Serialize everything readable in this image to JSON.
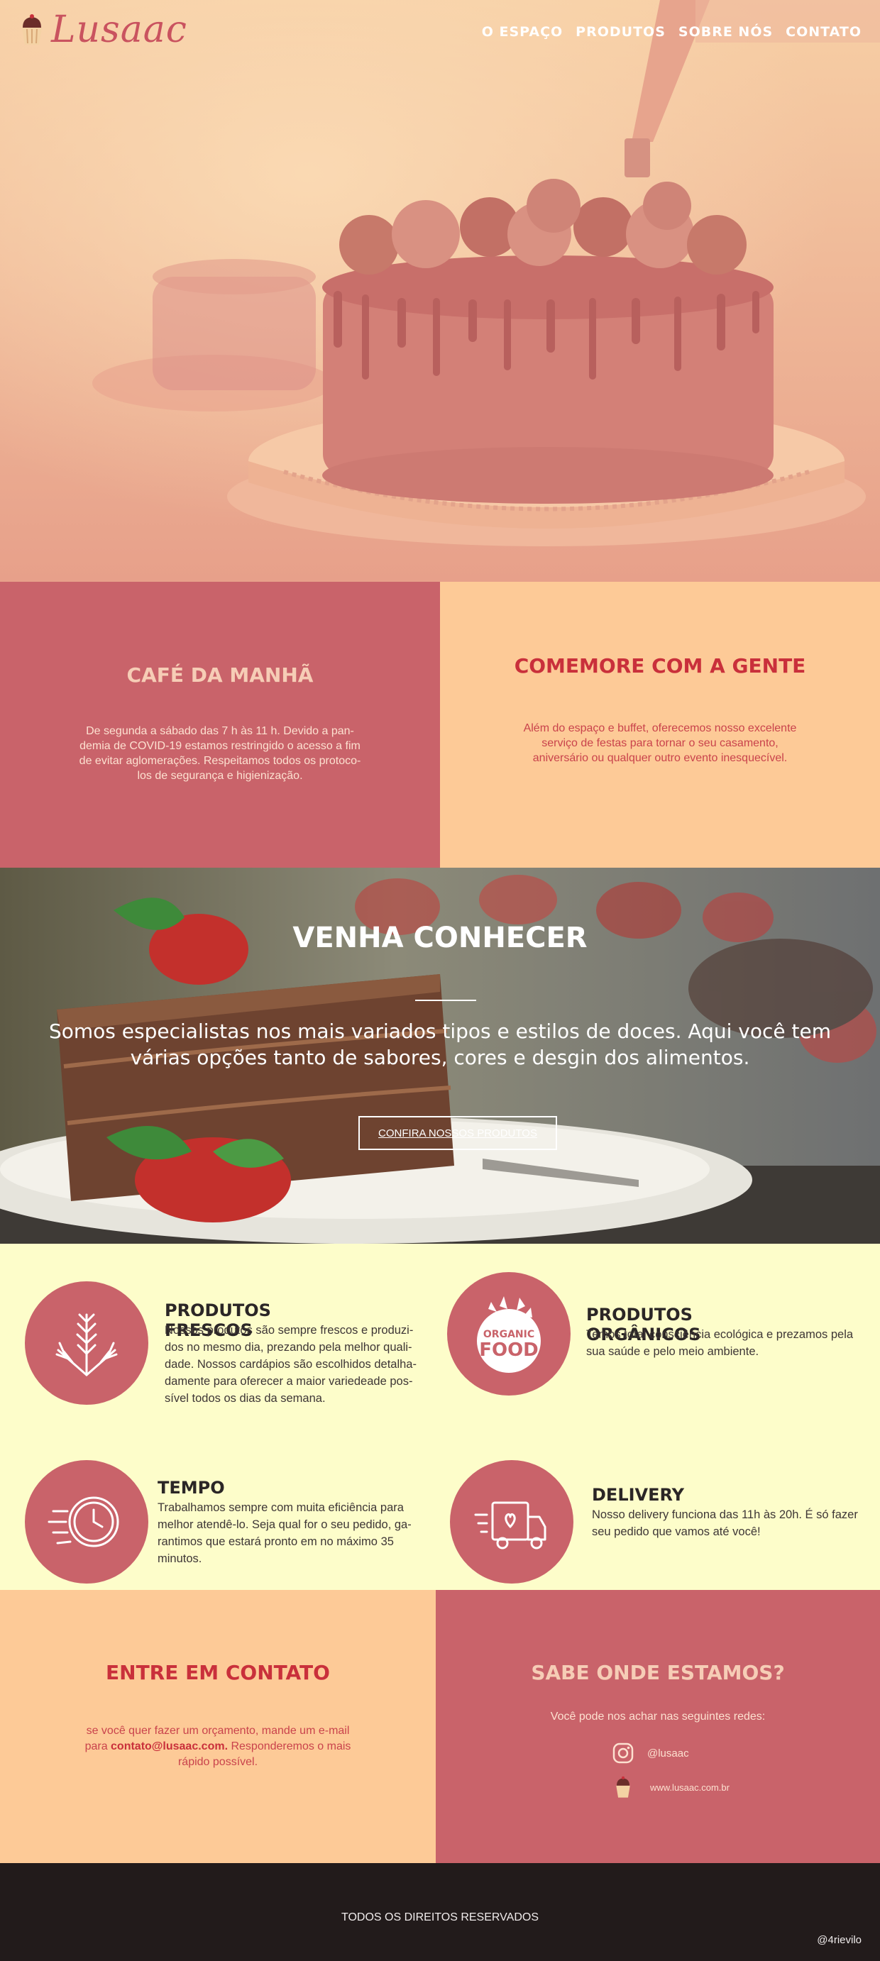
{
  "header": {
    "logo_text": "Lusaac",
    "nav": [
      "O ESPAÇO",
      "PRODUTOS",
      "SOBRE NÓS",
      "CONTATO"
    ]
  },
  "panels": {
    "cafe": {
      "title": "CAFÉ DA MANHÃ",
      "text_lines": [
        "De segunda a sábado das 7 h às 11 h.  Devido a  pan-",
        "demia de COVID-19 estamos restringido o acesso a fim",
        "de evitar aglomerações. Respeitamos todos os protoco-",
        "los de segurança e higienização."
      ]
    },
    "comemore": {
      "title": "COMEMORE COM A GENTE",
      "text_lines": [
        "Além do espaço e buffet, oferecemos nosso excelente",
        "serviço de festas para tornar o seu casamento,",
        "aniversário ou qualquer outro evento inesquecível."
      ]
    }
  },
  "venha": {
    "title": "VENHA CONHECER",
    "text_lines": [
      "Somos especialistas nos mais variados tipos e estilos de doces. Aqui você tem",
      "várias opções tanto de sabores, cores e desgin dos alimentos."
    ],
    "button": "CONFIRA NOSSOS PRODUTOS"
  },
  "features": {
    "frescos": {
      "title": "PRODUTOS FRESCOS",
      "icon": "wheat-icon",
      "text_lines": [
        "Nossos produtos são sempre frescos e produzi-",
        "dos no mesmo dia, prezando pela melhor quali-",
        "dade. Nossos cardápios são escolhidos detalha-",
        "damente para oferecer a maior variedeade pos-",
        "sível todos os dias da semana."
      ]
    },
    "organicos": {
      "title": "PRODUTOS ORGÂNICOS",
      "icon": "organic-food-icon",
      "badge_top": "ORGANIC",
      "badge_bottom": "FOOD",
      "text_lines": [
        "Temos total consciência ecológica e prezamos pela",
        "sua saúde e pelo meio ambiente."
      ]
    },
    "tempo": {
      "title": "TEMPO",
      "icon": "fast-clock-icon",
      "text_lines": [
        "Trabalhamos sempre com muita eficiência para",
        "melhor atendê-lo. Seja qual for o seu pedido, ga-",
        "rantimos que estará pronto em no máximo 35",
        "minutos."
      ]
    },
    "delivery": {
      "title": "DELIVERY",
      "icon": "delivery-truck-icon",
      "text_lines": [
        "Nosso delivery funciona das 11h às 20h. É só fazer",
        "seu pedido que vamos até você!"
      ]
    }
  },
  "contact": {
    "title": "ENTRE EM CONTATO",
    "line1": "se você quer fazer um orçamento, mande um e-mail",
    "line2_prefix": "para ",
    "email": "contato@lusaac.com.",
    "line2_suffix": " Responderemos o mais",
    "line3": "rápido possível."
  },
  "where": {
    "title": "SABE ONDE ESTAMOS?",
    "intro": "Você pode nos achar nas seguintes redes:",
    "instagram": "@lusaac",
    "website": "www.lusaac.com.br"
  },
  "footer": {
    "rights": "TODOS OS DIREITOS RESERVADOS",
    "signature": "@4rievilo"
  },
  "colors": {
    "brand_red": "#c9636a",
    "peach": "#fdca97",
    "cream": "#fdfdca",
    "dark": "#221b1b",
    "title_red": "#c9303b"
  }
}
